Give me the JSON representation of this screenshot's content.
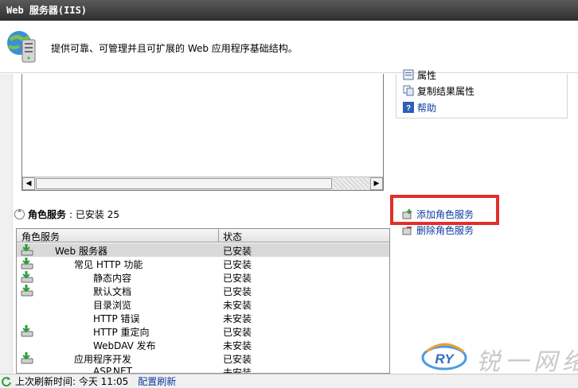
{
  "window": {
    "title": "Web 服务器(IIS)"
  },
  "header": {
    "description": "提供可靠、可管理并且可扩展的 Web 应用程序基础结构。"
  },
  "actions": [
    {
      "label": "属性",
      "icon": "properties-icon"
    },
    {
      "label": "复制结果属性",
      "icon": "copy-icon"
    },
    {
      "label": "帮助",
      "icon": "help-icon"
    }
  ],
  "role_services": {
    "section_label": "角色服务",
    "installed_summary": ": 已安装 25",
    "add_label": "添加角色服务",
    "remove_label": "删除角色服务",
    "columns": [
      "角色服务",
      "状态"
    ],
    "rows": [
      {
        "name": "Web 服务器",
        "status": "已安装",
        "installed": true,
        "selected": true
      },
      {
        "name": "常见 HTTP 功能",
        "status": "已安装",
        "installed": true
      },
      {
        "name": "静态内容",
        "status": "已安装",
        "installed": true
      },
      {
        "name": "默认文档",
        "status": "已安装",
        "installed": true
      },
      {
        "name": "目录浏览",
        "status": "未安装",
        "installed": false
      },
      {
        "name": "HTTP 错误",
        "status": "未安装",
        "installed": false
      },
      {
        "name": "HTTP 重定向",
        "status": "已安装",
        "installed": true
      },
      {
        "name": "WebDAV 发布",
        "status": "未安装",
        "installed": false
      },
      {
        "name": "应用程序开发",
        "status": "已安装",
        "installed": true
      },
      {
        "name": "ASP.NET",
        "status": "未安装",
        "installed": false
      }
    ]
  },
  "statusbar": {
    "last_refresh": "上次刷新时间: 今天 11:05",
    "config_refresh": "配置刷新"
  },
  "watermark": {
    "logo_text": "RY",
    "text": "锐一网络"
  },
  "colors": {
    "highlight": "#e0302c",
    "link": "#0b3b9e"
  }
}
